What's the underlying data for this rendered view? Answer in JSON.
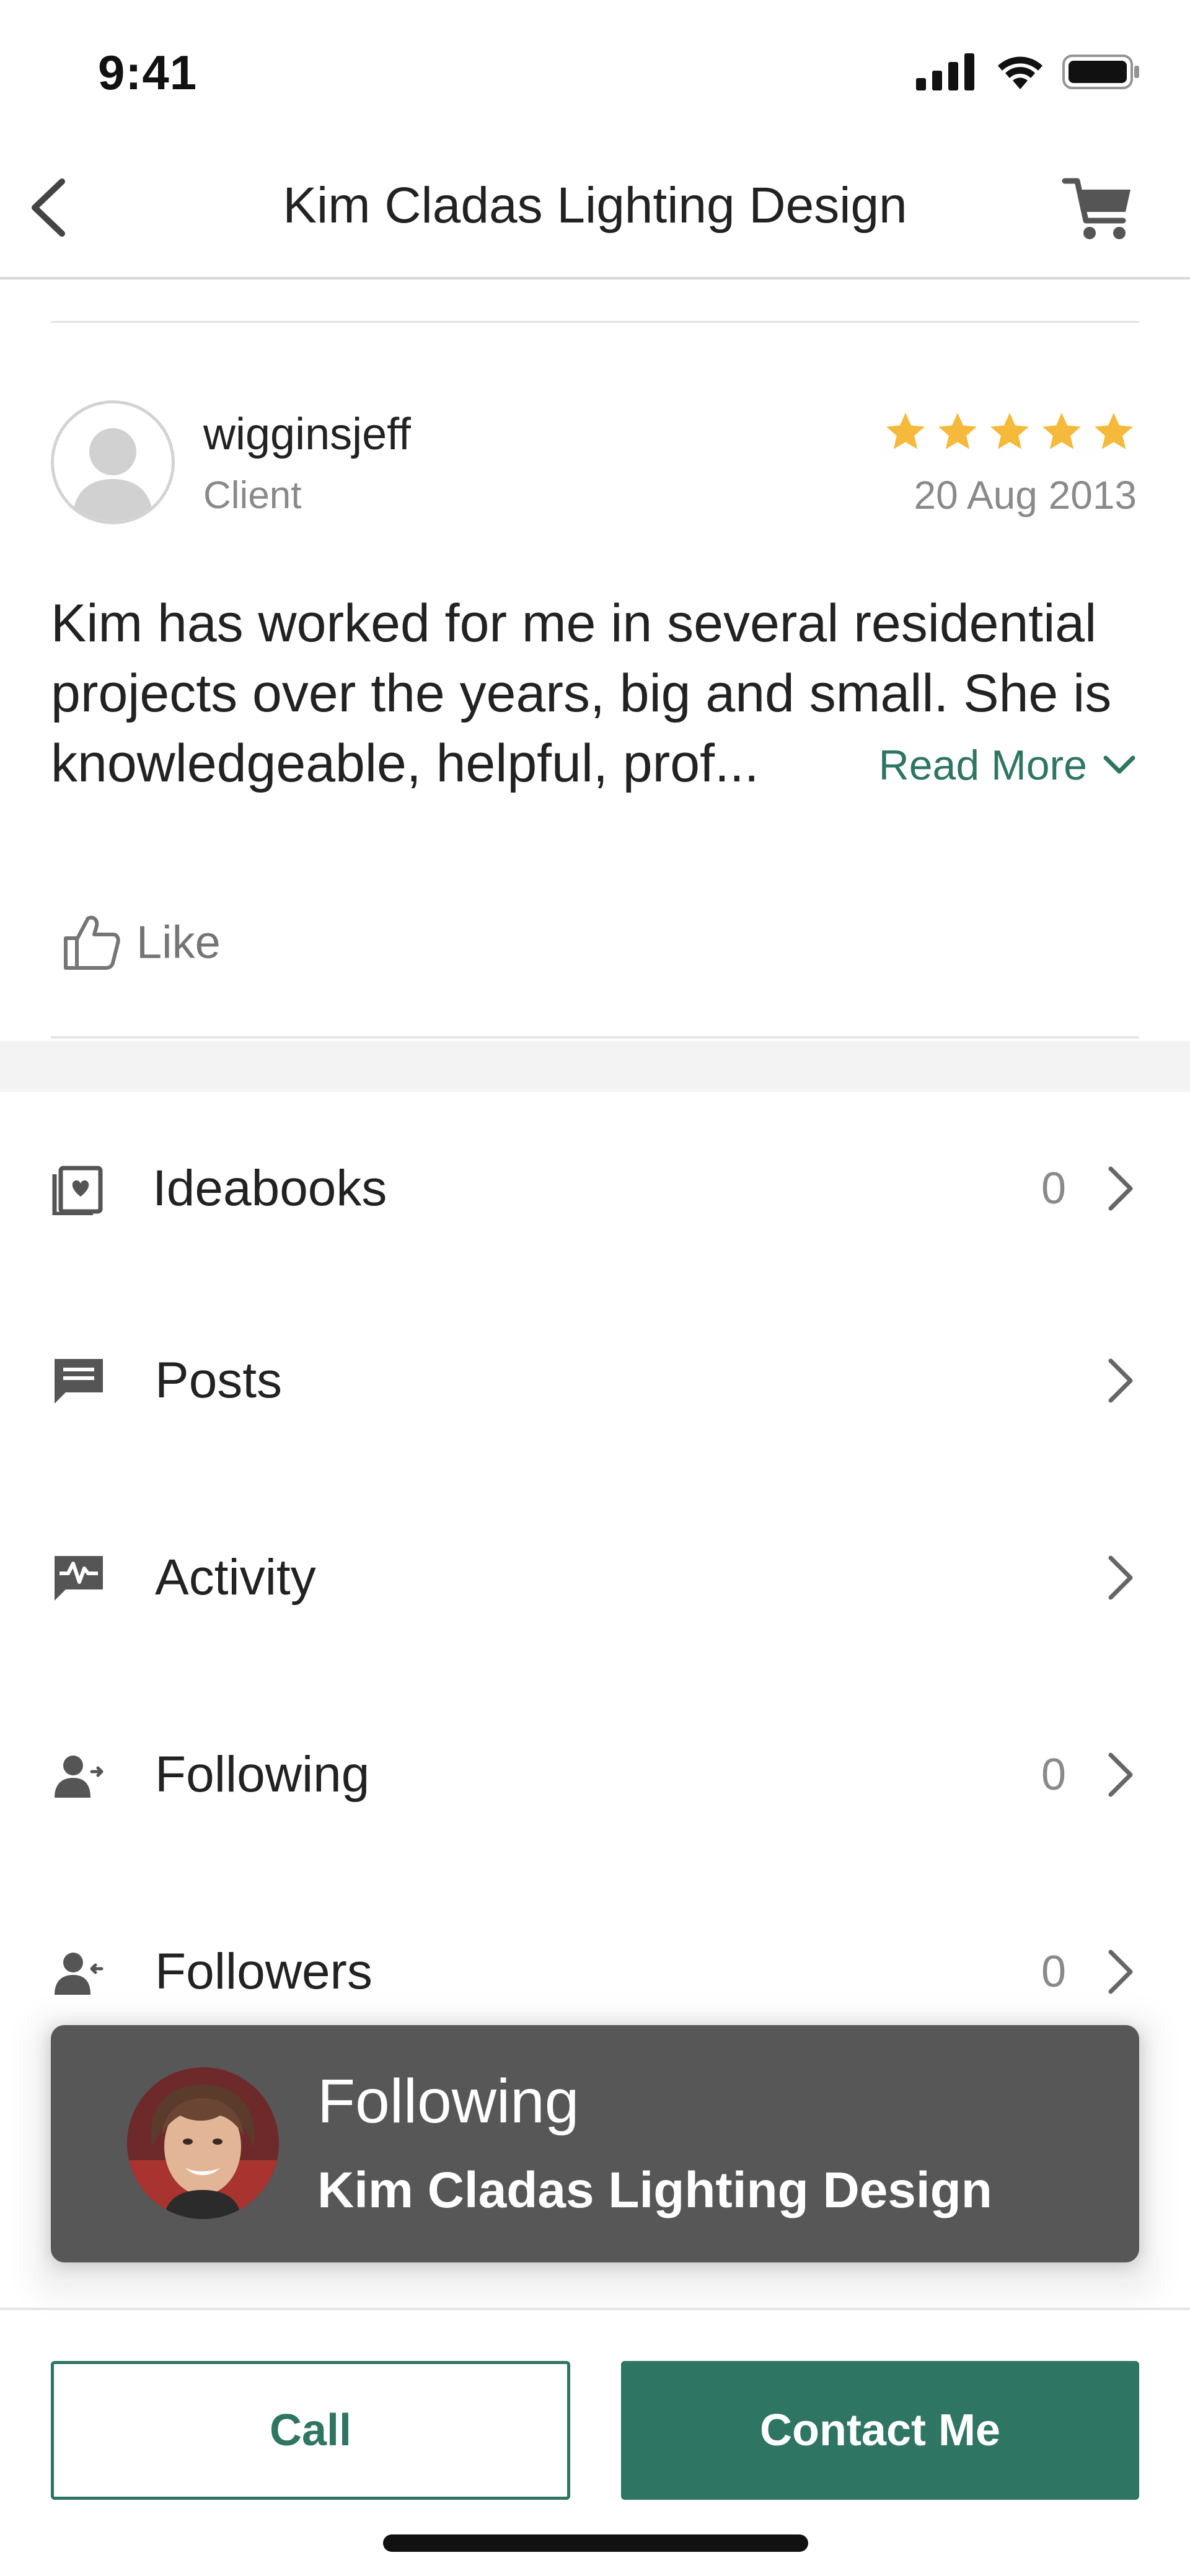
{
  "status_bar": {
    "time": "9:41"
  },
  "nav": {
    "title": "Kim Cladas Lighting Design"
  },
  "review": {
    "reviewer": "wigginsjeff",
    "role": "Client",
    "rating": 5,
    "date": "20 Aug 2013",
    "text": "Kim has worked for me in several residential projects over the years, big and small. She is knowledgeable, helpful, prof...",
    "read_more": "Read More",
    "like_label": "Like",
    "star_color": "#f5b93b"
  },
  "menu": [
    {
      "icon": "ideabook-icon",
      "label": "Ideabooks",
      "count": "0"
    },
    {
      "icon": "posts-icon",
      "label": "Posts",
      "count": ""
    },
    {
      "icon": "activity-icon",
      "label": "Activity",
      "count": ""
    },
    {
      "icon": "following-icon",
      "label": "Following",
      "count": "0"
    },
    {
      "icon": "followers-icon",
      "label": "Followers",
      "count": "0"
    }
  ],
  "toast": {
    "title": "Following",
    "subtitle": "Kim Cladas Lighting Design"
  },
  "actions": {
    "call": "Call",
    "contact": "Contact Me",
    "accent_color": "#2f7563"
  }
}
